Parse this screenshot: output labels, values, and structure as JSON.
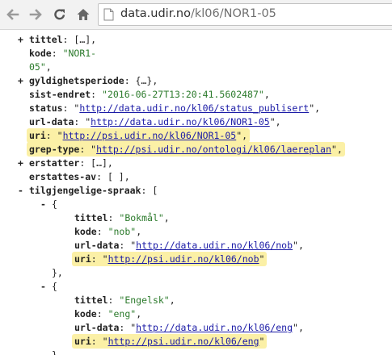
{
  "browser": {
    "url_host": "data.udir.no",
    "url_path": "/kl06/NOR1-05"
  },
  "lines": [
    {
      "indent": 0,
      "toggle": "+",
      "parts": [
        {
          "t": "k",
          "v": "tittel"
        },
        {
          "t": "p",
          "v": ": […],"
        }
      ]
    },
    {
      "indent": 0,
      "parts": [
        {
          "t": "k",
          "v": "kode"
        },
        {
          "t": "p",
          "v": ": "
        },
        {
          "t": "s",
          "v": "\"NOR1-"
        }
      ]
    },
    {
      "indent": 0,
      "parts": [
        {
          "t": "s",
          "v": "05\""
        },
        {
          "t": "p",
          "v": ","
        }
      ]
    },
    {
      "indent": 0,
      "toggle": "+",
      "parts": [
        {
          "t": "k",
          "v": "gyldighetsperiode"
        },
        {
          "t": "p",
          "v": ": {…},"
        }
      ]
    },
    {
      "indent": 0,
      "parts": [
        {
          "t": "k",
          "v": "sist-endret"
        },
        {
          "t": "p",
          "v": ": "
        },
        {
          "t": "s",
          "v": "\"2016-06-27T13:20:41.5602487\""
        },
        {
          "t": "p",
          "v": ","
        }
      ]
    },
    {
      "indent": 0,
      "parts": [
        {
          "t": "k",
          "v": "status"
        },
        {
          "t": "p",
          "v": ": \""
        },
        {
          "t": "a",
          "v": "http://data.udir.no/kl06/status_publisert"
        },
        {
          "t": "p",
          "v": "\","
        }
      ]
    },
    {
      "indent": 0,
      "parts": [
        {
          "t": "k",
          "v": "url-data"
        },
        {
          "t": "p",
          "v": ": \""
        },
        {
          "t": "a",
          "v": "http://data.udir.no/kl06/NOR1-05"
        },
        {
          "t": "p",
          "v": "\","
        }
      ]
    },
    {
      "indent": 0,
      "hl": true,
      "parts": [
        {
          "t": "k",
          "v": "uri"
        },
        {
          "t": "p",
          "v": ": \""
        },
        {
          "t": "a",
          "v": "http://psi.udir.no/kl06/NOR1-05"
        },
        {
          "t": "p",
          "v": "\","
        }
      ]
    },
    {
      "indent": 0,
      "hl": true,
      "parts": [
        {
          "t": "k",
          "v": "grep-type"
        },
        {
          "t": "p",
          "v": ": \""
        },
        {
          "t": "a",
          "v": "http://psi.udir.no/ontologi/kl06/laereplan"
        },
        {
          "t": "p",
          "v": "\","
        }
      ]
    },
    {
      "indent": 0,
      "toggle": "+",
      "parts": [
        {
          "t": "k",
          "v": "erstatter"
        },
        {
          "t": "p",
          "v": ": […],"
        }
      ]
    },
    {
      "indent": 0,
      "parts": [
        {
          "t": "k",
          "v": "erstattes-av"
        },
        {
          "t": "p",
          "v": ": [ ],"
        }
      ]
    },
    {
      "indent": 0,
      "toggle": "-",
      "parts": [
        {
          "t": "k",
          "v": "tilgjengelige-spraak"
        },
        {
          "t": "p",
          "v": ": ["
        }
      ]
    },
    {
      "indent": 1,
      "toggle": "-",
      "parts": [
        {
          "t": "p",
          "v": "{"
        }
      ]
    },
    {
      "indent": 2,
      "parts": [
        {
          "t": "k",
          "v": "tittel"
        },
        {
          "t": "p",
          "v": ": "
        },
        {
          "t": "s",
          "v": "\"Bokmål\""
        },
        {
          "t": "p",
          "v": ","
        }
      ]
    },
    {
      "indent": 2,
      "parts": [
        {
          "t": "k",
          "v": "kode"
        },
        {
          "t": "p",
          "v": ": "
        },
        {
          "t": "s",
          "v": "\"nob\""
        },
        {
          "t": "p",
          "v": ","
        }
      ]
    },
    {
      "indent": 2,
      "parts": [
        {
          "t": "k",
          "v": "url-data"
        },
        {
          "t": "p",
          "v": ": \""
        },
        {
          "t": "a",
          "v": "http://data.udir.no/kl06/nob"
        },
        {
          "t": "p",
          "v": "\","
        }
      ]
    },
    {
      "indent": 2,
      "hl": true,
      "parts": [
        {
          "t": "k",
          "v": "uri"
        },
        {
          "t": "p",
          "v": ": \""
        },
        {
          "t": "a",
          "v": "http://psi.udir.no/kl06/nob"
        },
        {
          "t": "p",
          "v": "\""
        }
      ]
    },
    {
      "indent": 1,
      "parts": [
        {
          "t": "p",
          "v": "},"
        }
      ]
    },
    {
      "indent": 1,
      "toggle": "-",
      "parts": [
        {
          "t": "p",
          "v": "{"
        }
      ]
    },
    {
      "indent": 2,
      "parts": [
        {
          "t": "k",
          "v": "tittel"
        },
        {
          "t": "p",
          "v": ": "
        },
        {
          "t": "s",
          "v": "\"Engelsk\""
        },
        {
          "t": "p",
          "v": ","
        }
      ]
    },
    {
      "indent": 2,
      "parts": [
        {
          "t": "k",
          "v": "kode"
        },
        {
          "t": "p",
          "v": ": "
        },
        {
          "t": "s",
          "v": "\"eng\""
        },
        {
          "t": "p",
          "v": ","
        }
      ]
    },
    {
      "indent": 2,
      "parts": [
        {
          "t": "k",
          "v": "url-data"
        },
        {
          "t": "p",
          "v": ": \""
        },
        {
          "t": "a",
          "v": "http://data.udir.no/kl06/eng"
        },
        {
          "t": "p",
          "v": "\","
        }
      ]
    },
    {
      "indent": 2,
      "hl": true,
      "parts": [
        {
          "t": "k",
          "v": "uri"
        },
        {
          "t": "p",
          "v": ": \""
        },
        {
          "t": "a",
          "v": "http://psi.udir.no/kl06/eng"
        },
        {
          "t": "p",
          "v": "\""
        }
      ]
    },
    {
      "indent": 1,
      "parts": [
        {
          "t": "p",
          "v": "},"
        }
      ]
    }
  ]
}
